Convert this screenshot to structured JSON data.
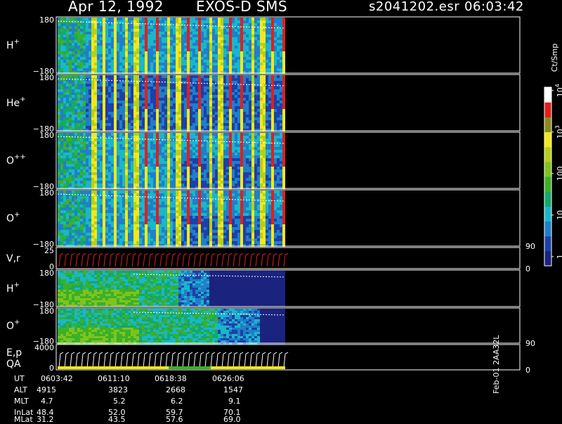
{
  "header": {
    "date": "Apr 12, 1992",
    "instrument": "EXOS-D SMS",
    "file": "s2041202.esr",
    "time": "06:03:42"
  },
  "colors": {
    "background": "#000000",
    "low": "#1e2a8c",
    "cyan": "#19b7c9",
    "green": "#3bb02a",
    "yellow": "#f2e81a",
    "red": "#e0201a"
  },
  "chart_data": {
    "type": "heatmap",
    "colorbar": {
      "unit": "Ct/Smp",
      "ticks": [
        {
          "value": 1,
          "label": "1"
        },
        {
          "value": 10,
          "label": "10"
        },
        {
          "value": 100,
          "label": "100"
        },
        {
          "value": 1000,
          "label": "10",
          "sup": "3"
        },
        {
          "value": 10000,
          "label": "10",
          "sup": "4"
        }
      ],
      "range": [
        0.6,
        12000
      ]
    },
    "panels": [
      {
        "id": "h-plus",
        "label": "H",
        "sup": "+",
        "ymax": "180",
        "ymin": "−180",
        "kind": "pitch"
      },
      {
        "id": "he-plus",
        "label": "He",
        "sup": "+",
        "ymax": "180",
        "ymin": "−180",
        "kind": "pitch"
      },
      {
        "id": "o-pp",
        "label": "O",
        "sup": "++",
        "ymax": "180",
        "ymin": "−180",
        "kind": "pitch"
      },
      {
        "id": "o-plus",
        "label": "O",
        "sup": "+",
        "ymax": "180",
        "ymin": "−180",
        "kind": "pitch"
      },
      {
        "id": "vr",
        "label": "V,r",
        "ymax": "25",
        "ymin": "0",
        "right_max": "90",
        "right_min": "0",
        "kind": "trace"
      },
      {
        "id": "h-plus-2",
        "label": "H",
        "sup": "+",
        "ymax": "180",
        "ymin": "−180",
        "kind": "energy"
      },
      {
        "id": "o-plus-2",
        "label": "O",
        "sup": "+",
        "ymax": "180",
        "ymin": "−180",
        "kind": "energy"
      },
      {
        "id": "ep",
        "label": "E,p",
        "label2": "QA",
        "ymax": "4000",
        "ymin": "0",
        "right_max": "90",
        "right_min": "0",
        "kind": "trace"
      }
    ],
    "orbit_table": {
      "rows": [
        {
          "name": "UT",
          "values": [
            "0603:42",
            "0611:10",
            "0618:38",
            "0626:06"
          ]
        },
        {
          "name": "ALT",
          "values": [
            "4915",
            "3823",
            "2668",
            "1547"
          ]
        },
        {
          "name": "MLT",
          "values": [
            "4.7",
            "5.2",
            "6.2",
            "9.1"
          ]
        },
        {
          "name": "InLat",
          "values": [
            "48.4",
            "52.0",
            "59.7",
            "70.1"
          ]
        },
        {
          "name": "MLat",
          "values": [
            "31.2",
            "43.5",
            "57.6",
            "69.0"
          ]
        }
      ]
    },
    "footer_id": "Feb-01 2AA32L"
  }
}
